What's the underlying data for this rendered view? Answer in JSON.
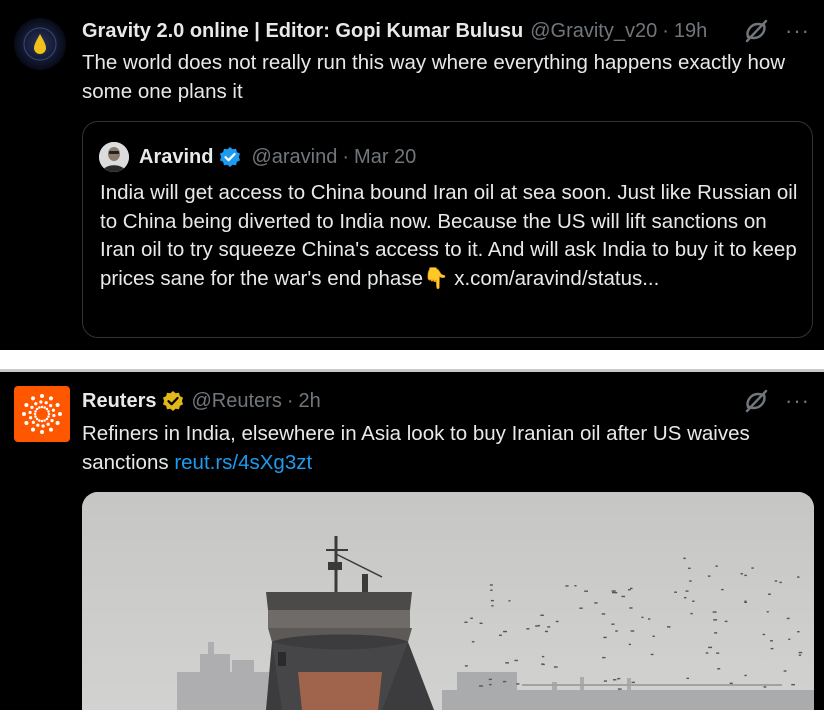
{
  "tweet1": {
    "author_name": "Gravity 2.0 online | Editor: Gopi Kumar Bulusu",
    "handle": "@Gravity_v20",
    "separator": "·",
    "time": "19h",
    "more_label": "···",
    "text": "The world does not really run this way where everything happens exactly how some one plans it",
    "icons": {
      "avatar": "oil-drop-avatar",
      "grok": "grok-icon",
      "more": "more-icon"
    },
    "quote": {
      "author_name": "Aravind",
      "handle": "@aravind",
      "separator": "·",
      "date": "Mar 20",
      "text_main": "India will get access to China bound Iran oil at sea soon. Just like Russian oil to China being diverted to India now. Because the US will lift sanctions on Iran oil to try squeeze China's access to it. And will ask India to buy it to keep prices sane for the war's end phase",
      "emoji": "👇",
      "text_link": " x.com/aravind/status...",
      "verified_color": "#1d9bf0"
    }
  },
  "tweet2": {
    "author_name": "Reuters",
    "handle": "@Reuters",
    "separator": "·",
    "time": "2h",
    "more_label": "···",
    "text": "Refiners in India, elsewhere in Asia look to buy Iranian oil after US waives sanctions",
    "link": "reut.rs/4sXg3zt",
    "verified_color": "#e2b719",
    "brand_color": "#ff5700",
    "image_description": "oil-tanker-photo"
  },
  "colors": {
    "background": "#000000",
    "text": "#e7e9ea",
    "secondary": "#71767b",
    "link": "#1d9bf0",
    "border": "#2f3336"
  }
}
